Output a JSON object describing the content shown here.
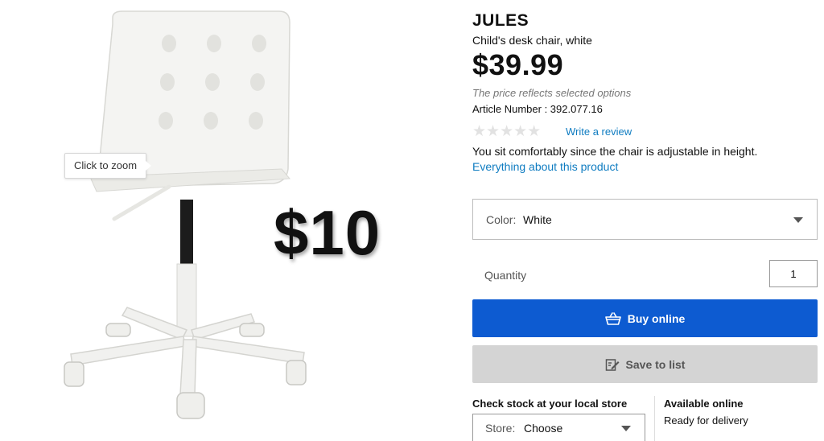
{
  "product_image": {
    "zoom_tooltip": "Click to zoom",
    "overlay_price": "$10"
  },
  "product": {
    "name": "JULES",
    "description": "Child's desk chair, white",
    "price": "$39.99",
    "price_note": "The price reflects selected options",
    "article_number": "Article Number : 392.077.16",
    "rating": {
      "stars_filled": 0,
      "stars_total": 5,
      "display": "★★★★★"
    },
    "write_review": "Write a review",
    "blurb": "You sit comfortably since the chair is adjustable in height.",
    "more_link": "Everything about this product"
  },
  "color_select": {
    "label": "Color:",
    "value": "White"
  },
  "quantity": {
    "label": "Quantity",
    "value": "1"
  },
  "buttons": {
    "buy_label": "Buy online",
    "buy_icon": "shopping-basket-icon",
    "save_label": "Save to list",
    "save_icon": "edit-list-icon"
  },
  "stock": {
    "title": "Check stock at your local store",
    "store_label": "Store:",
    "store_value": "Choose"
  },
  "availability": {
    "title": "Available online",
    "subtitle": "Ready for delivery"
  },
  "colors": {
    "buy_button": "#0d5bd1",
    "save_button": "#d4d4d4",
    "link": "#0f7cc1",
    "star_empty": "#e2e2e2"
  }
}
